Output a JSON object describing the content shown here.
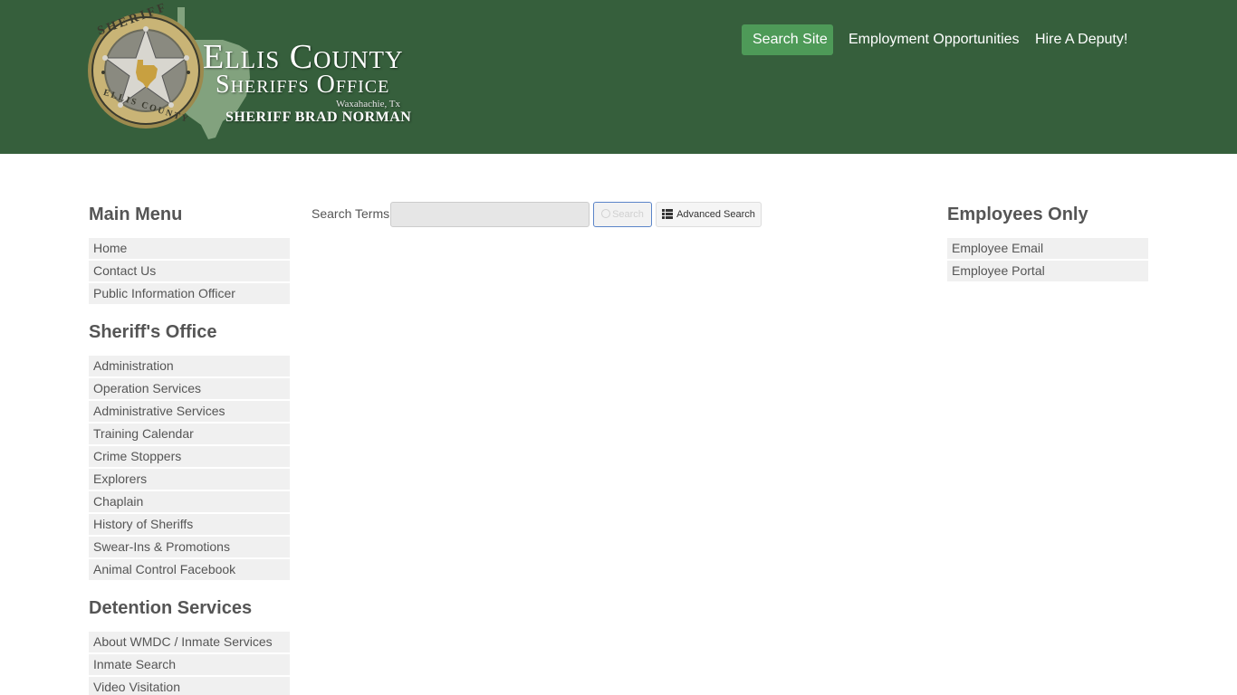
{
  "header": {
    "logo": {
      "badge_top": "SHERIFF",
      "badge_bottom": "ELLIS COUNTY",
      "title_line1": "Ellis County",
      "title_line2": "Sheriffs Office",
      "location": "Waxahachie, Tx",
      "sheriff": "SHERIFF BRAD NORMAN"
    },
    "nav": [
      {
        "label": "Search Site"
      },
      {
        "label": "Employment Opportunities"
      },
      {
        "label": "Hire A Deputy!"
      }
    ]
  },
  "search": {
    "label": "Search Terms:",
    "input_value": "",
    "button_label": "Search",
    "advanced_label": "Advanced Search"
  },
  "left_sidebar": {
    "sections": [
      {
        "title": "Main Menu",
        "items": [
          "Home",
          "Contact Us",
          "Public Information Officer"
        ]
      },
      {
        "title": "Sheriff's Office",
        "items": [
          "Administration",
          "Operation Services",
          "Administrative Services",
          "Training Calendar",
          "Crime Stoppers",
          "Explorers",
          "Chaplain",
          "History of Sheriffs",
          "Swear-Ins & Promotions",
          "Animal Control Facebook"
        ]
      },
      {
        "title": "Detention Services",
        "items": [
          "About WMDC / Inmate Services",
          "Inmate Search",
          "Video Visitation"
        ]
      }
    ]
  },
  "right_sidebar": {
    "title": "Employees Only",
    "items": [
      "Employee Email",
      "Employee Portal"
    ]
  },
  "colors": {
    "header_bg": "#365f3c",
    "nav_active": "#4e9a58",
    "menu_item_bg": "#f0f0f0"
  }
}
